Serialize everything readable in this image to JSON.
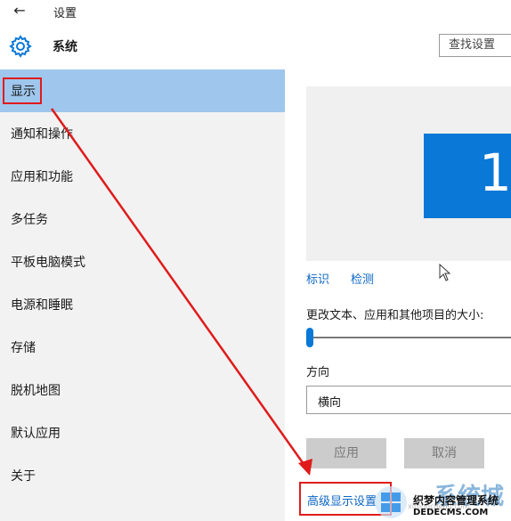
{
  "titlebar": {
    "title": "设置"
  },
  "header": {
    "title": "系统",
    "search_label": "查找设置"
  },
  "sidebar": {
    "items": [
      {
        "label": "显示"
      },
      {
        "label": "通知和操作"
      },
      {
        "label": "应用和功能"
      },
      {
        "label": "多任务"
      },
      {
        "label": "平板电脑模式"
      },
      {
        "label": "电源和睡眠"
      },
      {
        "label": "存储"
      },
      {
        "label": "脱机地图"
      },
      {
        "label": "默认应用"
      },
      {
        "label": "关于"
      }
    ]
  },
  "main": {
    "monitor_number": "1",
    "identify_link": "标识",
    "detect_link": "检测",
    "scale_label": "更改文本、应用和其他项目的大小:",
    "scale_slider_level": 0,
    "orientation_label": "方向",
    "orientation_value": "横向",
    "apply_label": "应用",
    "cancel_label": "取消",
    "advanced_link": "高级显示设置"
  },
  "watermark": {
    "brand": "系统城",
    "cms": "织梦内容管理系统",
    "url": "DEDECMS.COM",
    "sub": "xitongcheng.com"
  },
  "colors": {
    "accent": "#0a78d7",
    "selected": "#9fc6ec",
    "annotation": "#e01b1b",
    "link": "#0b66c3"
  }
}
